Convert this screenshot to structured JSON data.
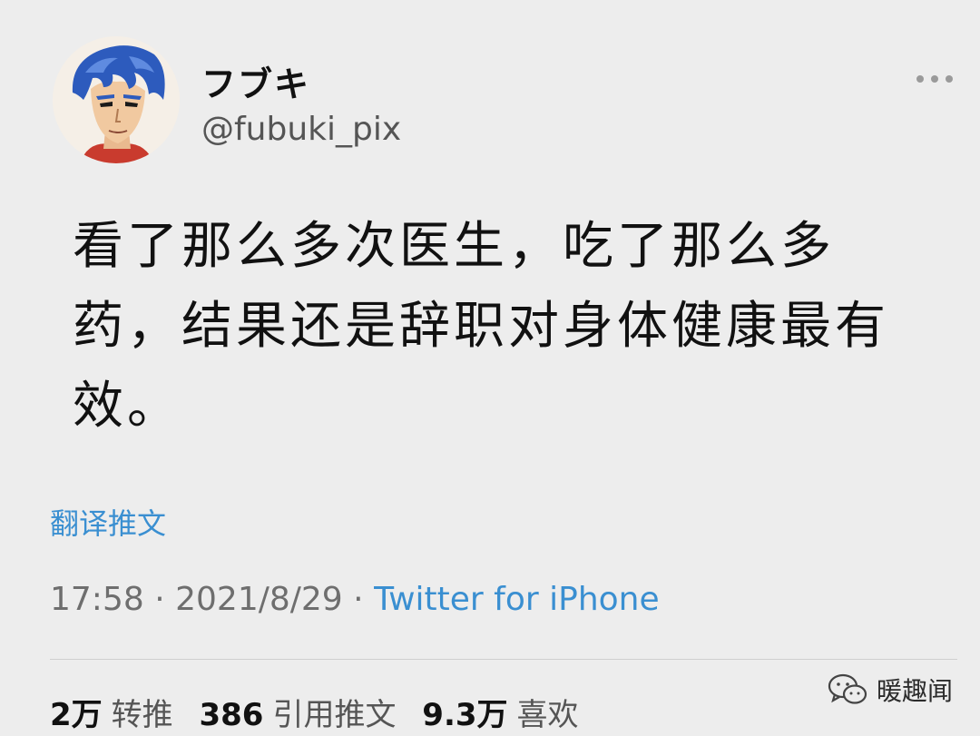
{
  "user": {
    "display_name": "フブキ",
    "handle": "@fubuki_pix"
  },
  "tweet": {
    "text": "看了那么多次医生，吃了那么多药，结果还是辞职对身体健康最有效。",
    "translate_label": "翻译推文",
    "time": "17:58",
    "separator": "·",
    "date": "2021/8/29",
    "source": "Twitter for iPhone"
  },
  "stats": {
    "retweets_count": "2万",
    "retweets_label": "转推",
    "quotes_count": "386",
    "quotes_label": "引用推文",
    "likes_count": "9.3万",
    "likes_label": "喜欢"
  },
  "watermark": {
    "text": "暖趣闻",
    "icon": "wechat-icon"
  },
  "icons": {
    "more": "more-options-icon",
    "avatar": "avatar"
  },
  "colors": {
    "link": "#3a8fd1",
    "background": "#ededed"
  }
}
